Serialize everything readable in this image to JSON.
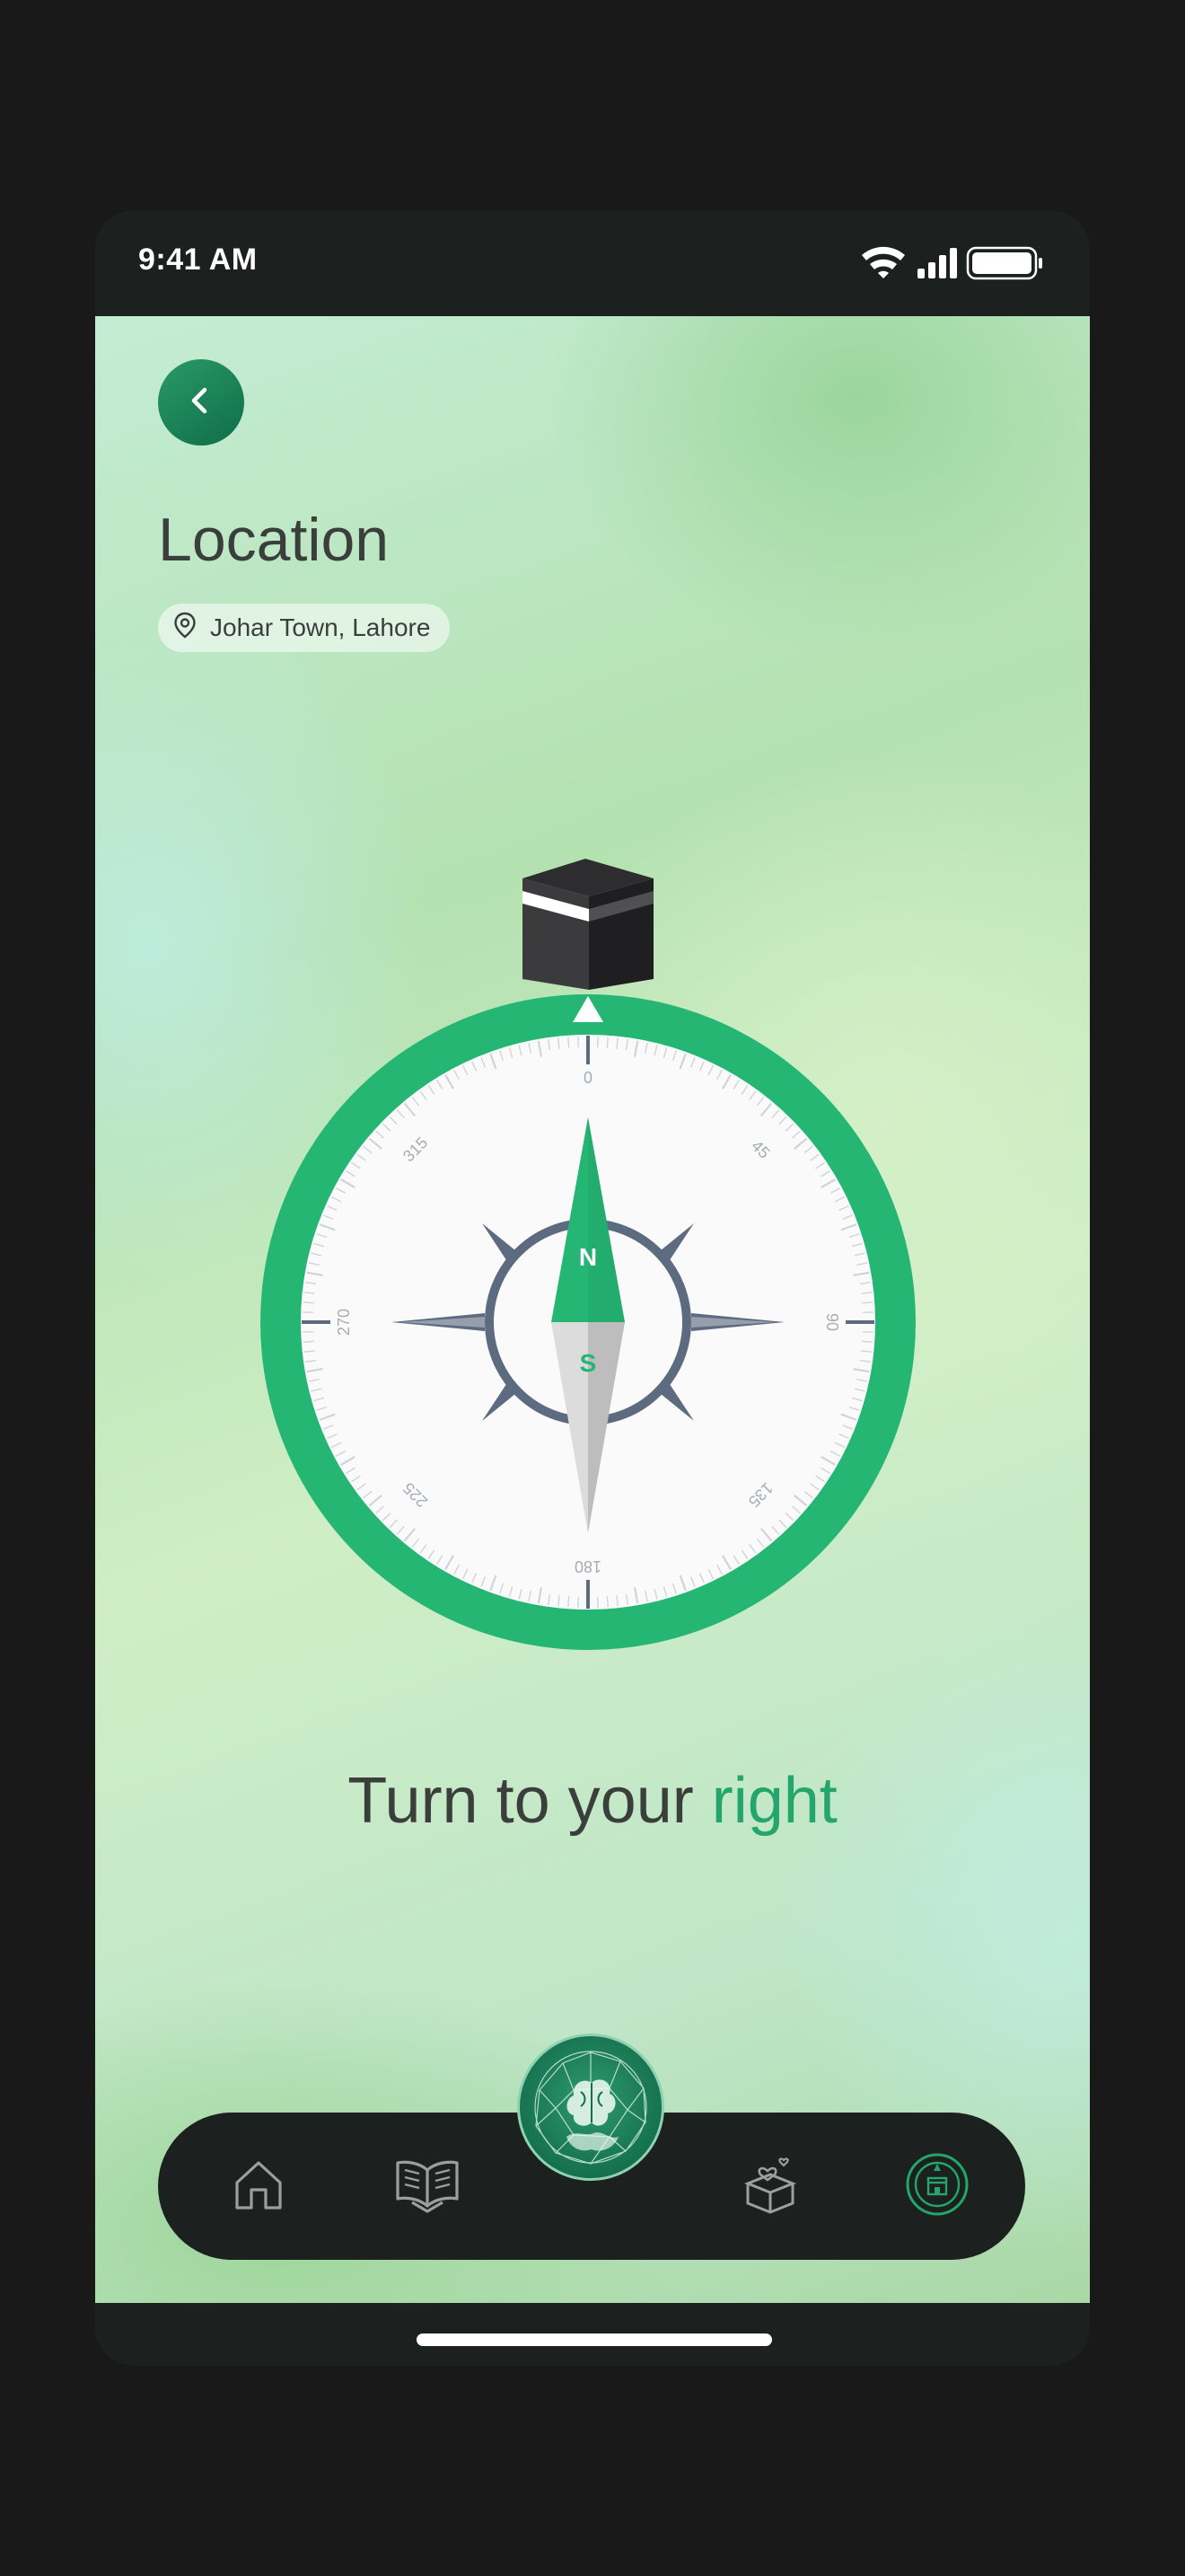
{
  "status_bar": {
    "time": "9:41 AM",
    "icons": [
      "wifi-icon",
      "cellular-signal-icon",
      "battery-icon"
    ]
  },
  "header": {
    "back_icon": "chevron-left-icon",
    "title": "Location",
    "location_icon": "map-pin-icon",
    "location": "Johar Town, Lahore"
  },
  "compass": {
    "target_icon": "kaaba-icon",
    "degree_labels": [
      "0",
      "45",
      "90",
      "135",
      "180",
      "225",
      "270",
      "315"
    ],
    "north_label": "N",
    "south_label": "S"
  },
  "instruction": {
    "prefix": "Turn to your ",
    "direction": "right"
  },
  "bottom_nav": {
    "items": [
      {
        "icon": "home-icon",
        "active": false
      },
      {
        "icon": "open-book-icon",
        "active": false
      },
      {
        "icon": "brain-globe-icon",
        "active": false,
        "center": true
      },
      {
        "icon": "donation-box-icon",
        "active": false
      },
      {
        "icon": "qibla-compass-icon",
        "active": true
      }
    ]
  },
  "colors": {
    "accent": "#23a56b",
    "compass_ring": "#26b673",
    "dark": "#1c211f",
    "needle_steel": "#5d6b80"
  }
}
